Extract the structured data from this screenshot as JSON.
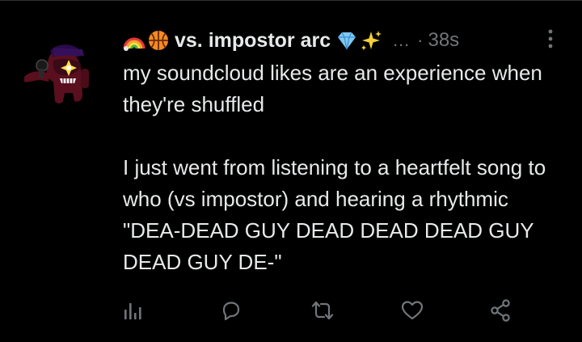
{
  "tweet": {
    "display_name": "vs. impostor arc",
    "handle_ellipsis": "…",
    "separator": "·",
    "time": "38s",
    "paragraph_1": "my soundcloud likes are an experience when they're shuffled",
    "paragraph_2": "I just went from listening to a heartfelt song to who (vs impostor) and hearing a rhythmic \"DEA-DEAD GUY DEAD DEAD DEAD GUY DEAD GUY DE-\""
  },
  "icons": {
    "name_prefix": [
      "rainbow-icon",
      "basketball-icon"
    ],
    "name_suffix": [
      "gem-icon",
      "sparkles-icon"
    ],
    "more": "more-options-icon",
    "actions": [
      "analytics-icon",
      "reply-icon",
      "retweet-icon",
      "like-icon",
      "share-icon"
    ]
  },
  "colors": {
    "background": "#000000",
    "text_primary": "#e7e9ea",
    "text_secondary": "#71767b"
  }
}
